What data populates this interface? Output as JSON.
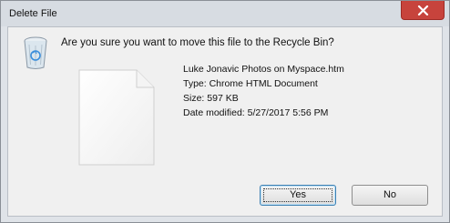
{
  "window": {
    "title": "Delete File",
    "close_icon": "close-icon"
  },
  "dialog": {
    "question": "Are you sure you want to move this file to the Recycle Bin?",
    "icon": "recycle-bin-icon",
    "file_icon": "file-icon",
    "file": {
      "name": "Luke Jonavic Photos on Myspace.htm",
      "type": "Type: Chrome HTML Document",
      "size": "Size: 597 KB",
      "date_modified": "Date modified: 5/27/2017 5:56 PM"
    }
  },
  "buttons": {
    "yes_label": "Yes",
    "no_label": "No"
  },
  "colors": {
    "close_button": "#c7433c",
    "frame": "#dfe3e8",
    "client": "#f0f0f0",
    "default_button_border": "#3c7fb1"
  }
}
